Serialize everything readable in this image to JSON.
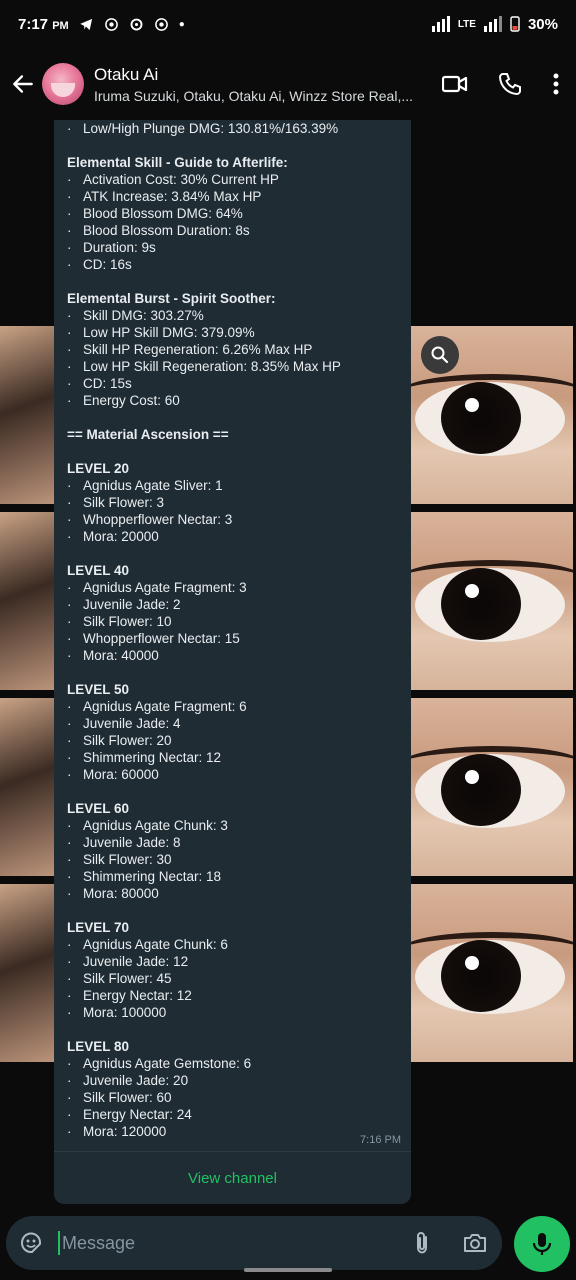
{
  "status_bar": {
    "time": "7:17",
    "ampm": "PM",
    "icons": [
      "telegram-icon",
      "whatsapp-icon",
      "chatgpt-icon",
      "whatsapp-icon",
      "dot-icon"
    ],
    "network": "LTE",
    "battery": "30%"
  },
  "header": {
    "title": "Otaku Ai",
    "subtitle": "Iruma Suzuki, Otaku, Otaku Ai, Winzz Store Real,...",
    "icons": [
      "back-arrow-icon",
      "video-call-icon",
      "phone-call-icon",
      "more-vert-icon"
    ]
  },
  "message": {
    "lines": [
      {
        "type": "bullet",
        "text": "Low/High Plunge DMG: 130.81%/163.39%"
      },
      {
        "type": "gap"
      },
      {
        "type": "header",
        "text": "Elemental Skill - Guide to Afterlife:"
      },
      {
        "type": "bullet",
        "text": "Activation Cost: 30% Current HP"
      },
      {
        "type": "bullet",
        "text": "ATK Increase: 3.84% Max HP"
      },
      {
        "type": "bullet",
        "text": "Blood Blossom DMG: 64%"
      },
      {
        "type": "bullet",
        "text": "Blood Blossom Duration: 8s"
      },
      {
        "type": "bullet",
        "text": "Duration: 9s"
      },
      {
        "type": "bullet",
        "text": "CD: 16s"
      },
      {
        "type": "gap"
      },
      {
        "type": "header",
        "text": "Elemental Burst - Spirit Soother:"
      },
      {
        "type": "bullet",
        "text": "Skill DMG: 303.27%"
      },
      {
        "type": "bullet",
        "text": "Low HP Skill DMG: 379.09%"
      },
      {
        "type": "bullet",
        "text": "Skill HP Regeneration: 6.26% Max HP"
      },
      {
        "type": "bullet",
        "text": "Low HP Skill Regeneration: 8.35% Max HP"
      },
      {
        "type": "bullet",
        "text": "CD: 15s"
      },
      {
        "type": "bullet",
        "text": "Energy Cost: 60"
      },
      {
        "type": "gap"
      },
      {
        "type": "header",
        "text": "== Material Ascension =="
      },
      {
        "type": "gap"
      },
      {
        "type": "header",
        "text": "LEVEL 20"
      },
      {
        "type": "bullet",
        "text": "Agnidus Agate Sliver: 1"
      },
      {
        "type": "bullet",
        "text": "Silk Flower: 3"
      },
      {
        "type": "bullet",
        "text": "Whopperflower Nectar: 3"
      },
      {
        "type": "bullet",
        "text": "Mora: 20000"
      },
      {
        "type": "gap"
      },
      {
        "type": "header",
        "text": "LEVEL 40"
      },
      {
        "type": "bullet",
        "text": "Agnidus Agate Fragment: 3"
      },
      {
        "type": "bullet",
        "text": "Juvenile Jade: 2"
      },
      {
        "type": "bullet",
        "text": "Silk Flower: 10"
      },
      {
        "type": "bullet",
        "text": "Whopperflower Nectar: 15"
      },
      {
        "type": "bullet",
        "text": "Mora: 40000"
      },
      {
        "type": "gap"
      },
      {
        "type": "header",
        "text": "LEVEL 50"
      },
      {
        "type": "bullet",
        "text": "Agnidus Agate Fragment: 6"
      },
      {
        "type": "bullet",
        "text": "Juvenile Jade: 4"
      },
      {
        "type": "bullet",
        "text": "Silk Flower: 20"
      },
      {
        "type": "bullet",
        "text": "Shimmering Nectar: 12"
      },
      {
        "type": "bullet",
        "text": "Mora: 60000"
      },
      {
        "type": "gap"
      },
      {
        "type": "header",
        "text": "LEVEL 60"
      },
      {
        "type": "bullet",
        "text": "Agnidus Agate Chunk: 3"
      },
      {
        "type": "bullet",
        "text": "Juvenile Jade: 8"
      },
      {
        "type": "bullet",
        "text": "Silk Flower: 30"
      },
      {
        "type": "bullet",
        "text": "Shimmering Nectar: 18"
      },
      {
        "type": "bullet",
        "text": "Mora: 80000"
      },
      {
        "type": "gap"
      },
      {
        "type": "header",
        "text": "LEVEL 70"
      },
      {
        "type": "bullet",
        "text": "Agnidus Agate Chunk: 6"
      },
      {
        "type": "bullet",
        "text": "Juvenile Jade: 12"
      },
      {
        "type": "bullet",
        "text": "Silk Flower: 45"
      },
      {
        "type": "bullet",
        "text": "Energy Nectar: 12"
      },
      {
        "type": "bullet",
        "text": "Mora: 100000"
      },
      {
        "type": "gap"
      },
      {
        "type": "header",
        "text": "LEVEL 80"
      },
      {
        "type": "bullet",
        "text": "Agnidus Agate Gemstone: 6"
      },
      {
        "type": "bullet",
        "text": "Juvenile Jade: 20"
      },
      {
        "type": "bullet",
        "text": "Silk Flower: 60"
      },
      {
        "type": "bullet",
        "text": "Energy Nectar: 24"
      },
      {
        "type": "bullet",
        "text": "Mora: 120000"
      }
    ],
    "bullet_char": "·",
    "time": "7:16 PM",
    "view_channel": "View channel"
  },
  "input": {
    "placeholder": "Message",
    "icons": [
      "sticker-icon",
      "attach-icon",
      "camera-icon",
      "mic-icon"
    ]
  },
  "colors": {
    "accent": "#21c063",
    "bubble": "#1f2c34",
    "background": "#0b0b0b"
  }
}
